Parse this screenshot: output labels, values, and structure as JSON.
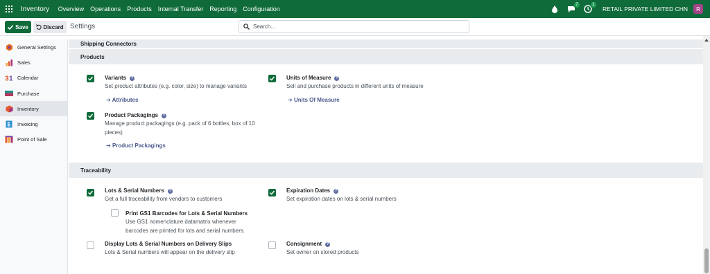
{
  "navbar": {
    "app_name": "Inventory",
    "menu": [
      "Overview",
      "Operations",
      "Products",
      "Internal Transfer",
      "Reporting",
      "Configuration"
    ],
    "messages_count": "7",
    "activities_count": "2",
    "company": "RETAIL PRIVATE LIMITED CHN",
    "avatar_initial": "R",
    "colors": {
      "bar": "#0f6b3a",
      "avatar": "#a24689"
    }
  },
  "control": {
    "save_label": "Save",
    "discard_label": "Discard",
    "title": "Settings",
    "search_placeholder": "Search..."
  },
  "sidebar": {
    "items": [
      {
        "label": "General Settings",
        "icon": "odoo-settings-icon"
      },
      {
        "label": "Sales",
        "icon": "sales-app-icon"
      },
      {
        "label": "Calendar",
        "icon": "calendar-app-icon"
      },
      {
        "label": "Purchase",
        "icon": "purchase-app-icon"
      },
      {
        "label": "Inventory",
        "icon": "inventory-app-icon",
        "active": true
      },
      {
        "label": "Invoicing",
        "icon": "invoicing-app-icon"
      },
      {
        "label": "Point of Sale",
        "icon": "point-of-sale-app-icon"
      }
    ]
  },
  "content": {
    "partial_heading": "Shipping Connectors",
    "products": {
      "heading": "Products",
      "variants": {
        "title": "Variants",
        "desc": "Set product attributes (e.g. color, size) to manage variants",
        "link": "Attributes",
        "checked": true
      },
      "uom": {
        "title": "Units of Measure",
        "desc": "Sell and purchase products in different units of measure",
        "link": "Units Of Measure",
        "checked": true
      },
      "packagings": {
        "title": "Product Packagings",
        "desc": "Manage product packagings (e.g. pack of 6 bottles, box of 10 pieces)",
        "link": "Product Packagings",
        "checked": true
      }
    },
    "traceability": {
      "heading": "Traceability",
      "lots": {
        "title": "Lots & Serial Numbers",
        "desc": "Get a full traceability from vendors to customers",
        "checked": true
      },
      "gs1": {
        "title": "Print GS1 Barcodes for Lots & Serial Numbers",
        "desc": "Use GS1 nomenclature datamatrix whenever barcodes are printed for lots and serial numbers.",
        "checked": false
      },
      "expiration": {
        "title": "Expiration Dates",
        "desc": "Set expiration dates on lots & serial numbers",
        "checked": true
      },
      "delivery_slips": {
        "title": "Display Lots & Serial Numbers on Delivery Slips",
        "desc": "Lots & Serial numbers will appear on the delivery slip",
        "checked": false
      },
      "consignment": {
        "title": "Consignment",
        "desc": "Set owner on stored products",
        "checked": false
      }
    }
  }
}
